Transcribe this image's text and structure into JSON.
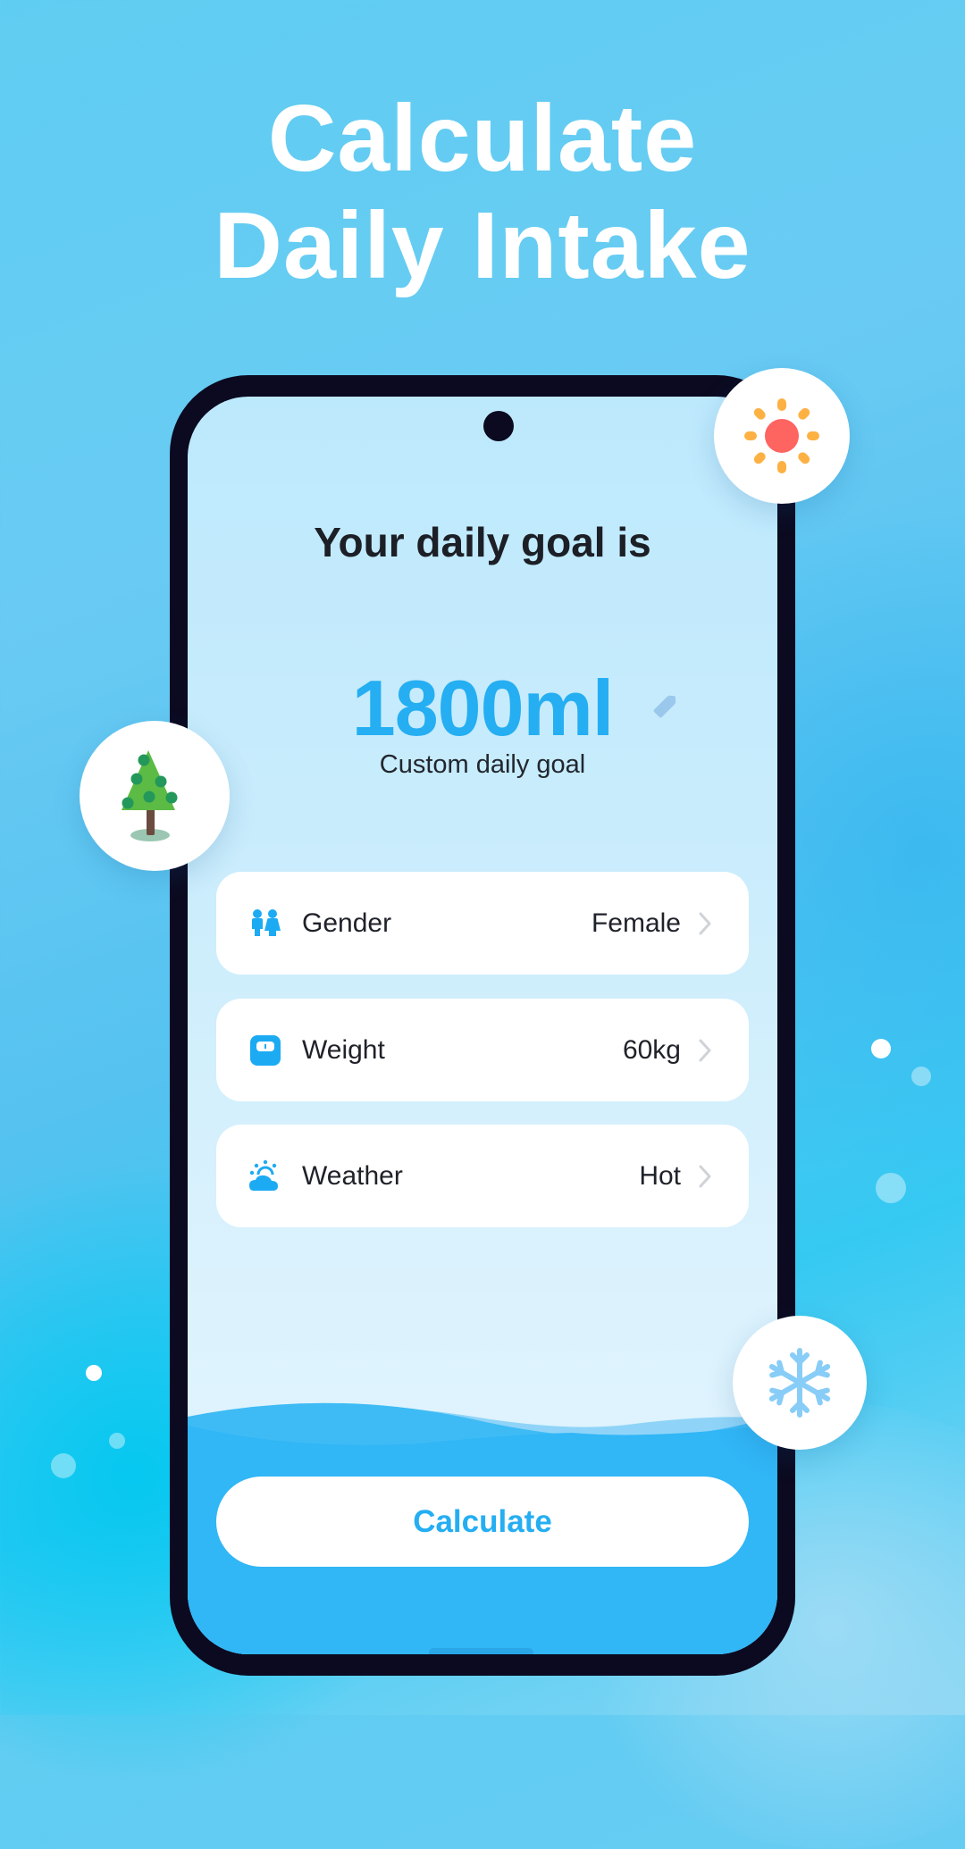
{
  "hero": {
    "line1": "Calculate",
    "line2": "Daily Intake"
  },
  "screen": {
    "heading": "Your daily goal is",
    "goal_value": "1800ml",
    "goal_subtitle": "Custom daily goal",
    "edit_icon": "pencil-icon",
    "settings": [
      {
        "icon": "gender-icon",
        "label": "Gender",
        "value": "Female"
      },
      {
        "icon": "weight-scale-icon",
        "label": "Weight",
        "value": "60kg"
      },
      {
        "icon": "weather-icon",
        "label": "Weather",
        "value": "Hot"
      }
    ],
    "calculate_label": "Calculate"
  },
  "decorations": {
    "bubbles": [
      "sun-icon",
      "tree-icon",
      "snowflake-icon"
    ]
  },
  "colors": {
    "accent": "#25aef2",
    "phone_frame": "#0b0a20",
    "text_dark": "#1c1f26",
    "sun_core": "#fe6460",
    "sun_rays": "#fdb143",
    "tree_green": "#5cbb44"
  }
}
